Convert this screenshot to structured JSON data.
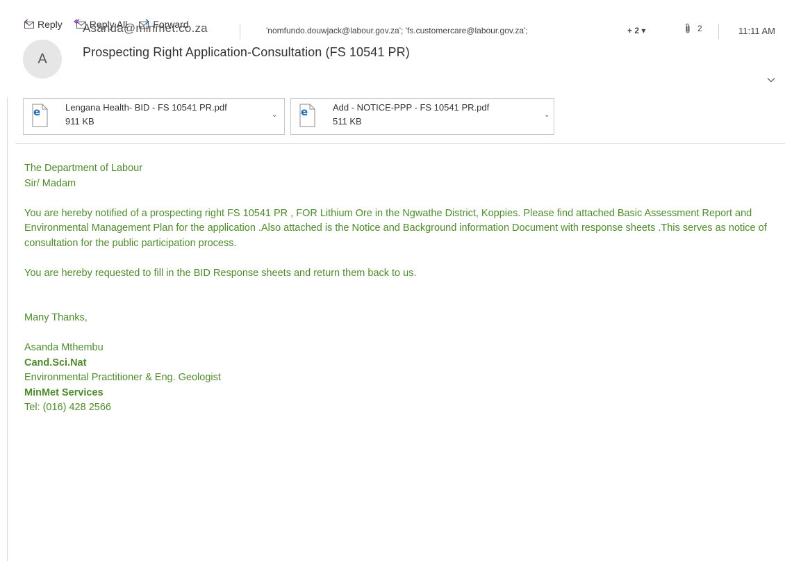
{
  "toolbar": {
    "reply_label": "Reply",
    "reply_all_label": "Reply All",
    "forward_label": "Forward"
  },
  "header": {
    "avatar_initial": "A",
    "sender": "Asanda@minmet.co.za",
    "recipients": "'nomfundo.douwjack@labour.gov.za'; 'fs.customercare@labour.gov.za';",
    "more_recipients": "+ 2 ▾",
    "attachment_count": "2",
    "time": "11:11 AM",
    "subject": "Prospecting Right Application-Consultation (FS 10541 PR)"
  },
  "attachments": [
    {
      "name": "Lengana Health- BID  - FS 10541 PR.pdf",
      "size": "911 KB",
      "type_label": "pdf",
      "icon": "pdf-file-icon"
    },
    {
      "name": "Add - NOTICE-PPP - FS 10541 PR.pdf",
      "size": "511 KB",
      "type_label": "pdf",
      "icon": "pdf-file-icon"
    }
  ],
  "body": {
    "greeting_line1": "The Department of Labour",
    "greeting_line2": "Sir/ Madam",
    "paragraph1": "You are hereby notified of a prospecting right FS 10541 PR , FOR Lithium Ore in the Ngwathe District, Koppies. Please find attached Basic Assessment Report and Environmental Management Plan for the application .Also attached is the Notice and Background information Document with response sheets .This serves as notice of consultation for the public participation process.",
    "paragraph2": "You are hereby requested to fill in the BID Response sheets and return them back to us.",
    "closing": "Many Thanks,"
  },
  "signature": {
    "name": "Asanda Mthembu",
    "qualification": "Cand.Sci.Nat",
    "title": "Environmental Practitioner & Eng. Geologist",
    "company": "MinMet Services",
    "phone": "Tel: (016) 428 2566"
  },
  "colors": {
    "body_text": "#4e8a2d",
    "pdf_icon_blue": "#1e6bb8"
  }
}
